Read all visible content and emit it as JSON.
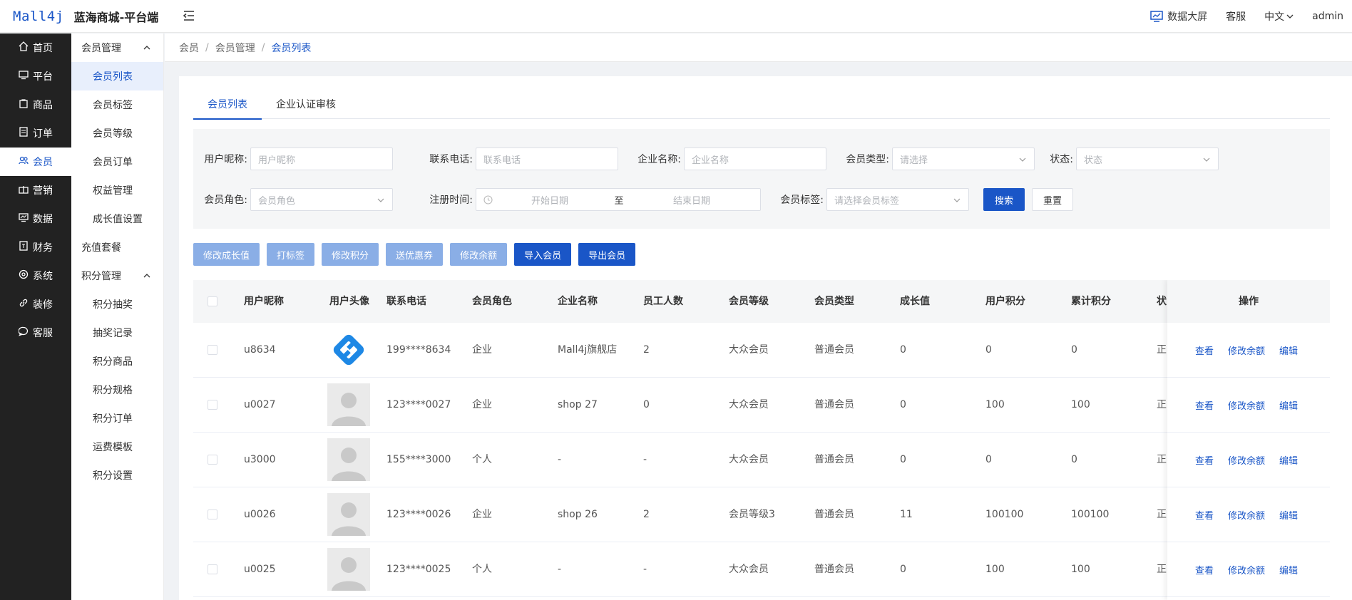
{
  "header": {
    "brand": "Mall4j",
    "site_title": "蓝海商城-平台端",
    "data_screen": "数据大屏",
    "service": "客服",
    "language": "中文",
    "user": "admin"
  },
  "sidebar": {
    "items": [
      {
        "label": "首页",
        "icon": "home-icon"
      },
      {
        "label": "平台",
        "icon": "monitor-icon"
      },
      {
        "label": "商品",
        "icon": "bag-icon"
      },
      {
        "label": "订单",
        "icon": "document-icon"
      },
      {
        "label": "会员",
        "icon": "users-icon",
        "active": true
      },
      {
        "label": "营销",
        "icon": "gift-icon"
      },
      {
        "label": "数据",
        "icon": "chart-icon"
      },
      {
        "label": "财务",
        "icon": "finance-icon"
      },
      {
        "label": "系统",
        "icon": "gear-icon"
      },
      {
        "label": "装修",
        "icon": "link-icon"
      },
      {
        "label": "客服",
        "icon": "chat-icon"
      }
    ]
  },
  "subnav": {
    "group1": "会员管理",
    "group1_items": [
      "会员列表",
      "会员标签",
      "会员等级",
      "会员订单",
      "权益管理",
      "成长值设置"
    ],
    "recharge": "充值套餐",
    "group2": "积分管理",
    "group2_items": [
      "积分抽奖",
      "抽奖记录",
      "积分商品",
      "积分规格",
      "积分订单",
      "运费模板",
      "积分设置"
    ]
  },
  "breadcrumb": [
    "会员",
    "会员管理",
    "会员列表"
  ],
  "tabs": [
    "会员列表",
    "企业认证审核"
  ],
  "filters": {
    "nickname_label": "用户昵称:",
    "nickname_ph": "用户昵称",
    "phone_label": "联系电话:",
    "phone_ph": "联系电话",
    "company_label": "企业名称:",
    "company_ph": "企业名称",
    "type_label": "会员类型:",
    "type_ph": "请选择",
    "status_label": "状态:",
    "status_ph": "状态",
    "role_label": "会员角色:",
    "role_ph": "会员角色",
    "reg_label": "注册时间:",
    "start_ph": "开始日期",
    "to": "至",
    "end_ph": "结束日期",
    "tag_label": "会员标签:",
    "tag_ph": "请选择会员标签",
    "search": "搜索",
    "reset": "重置"
  },
  "actions": [
    "修改成长值",
    "打标签",
    "修改积分",
    "送优惠券",
    "修改余额",
    "导入会员",
    "导出会员"
  ],
  "table": {
    "headers": [
      "用户昵称",
      "用户头像",
      "联系电话",
      "会员角色",
      "企业名称",
      "员工人数",
      "会员等级",
      "会员类型",
      "成长值",
      "用户积分",
      "累计积分",
      "状"
    ],
    "op_header": "操作",
    "op_links": [
      "查看",
      "修改余额",
      "编辑"
    ],
    "rows": [
      [
        "u8634",
        "logo",
        "199****8634",
        "企业",
        "Mall4j旗舰店",
        "2",
        "大众会员",
        "普通会员",
        "0",
        "0",
        "0",
        "正"
      ],
      [
        "u0027",
        "default",
        "123****0027",
        "企业",
        "shop 27",
        "0",
        "大众会员",
        "普通会员",
        "0",
        "100",
        "100",
        "正"
      ],
      [
        "u3000",
        "default",
        "155****3000",
        "个人",
        "-",
        "-",
        "大众会员",
        "普通会员",
        "0",
        "0",
        "0",
        "正"
      ],
      [
        "u0026",
        "default",
        "123****0026",
        "企业",
        "shop 26",
        "2",
        "会员等级3",
        "普通会员",
        "11",
        "100100",
        "100100",
        "正"
      ],
      [
        "u0025",
        "default",
        "123****0025",
        "个人",
        "-",
        "-",
        "大众会员",
        "普通会员",
        "0",
        "100",
        "100",
        "正"
      ]
    ]
  },
  "colors": {
    "primary": "#1a56c7",
    "sidebar": "#222222"
  }
}
